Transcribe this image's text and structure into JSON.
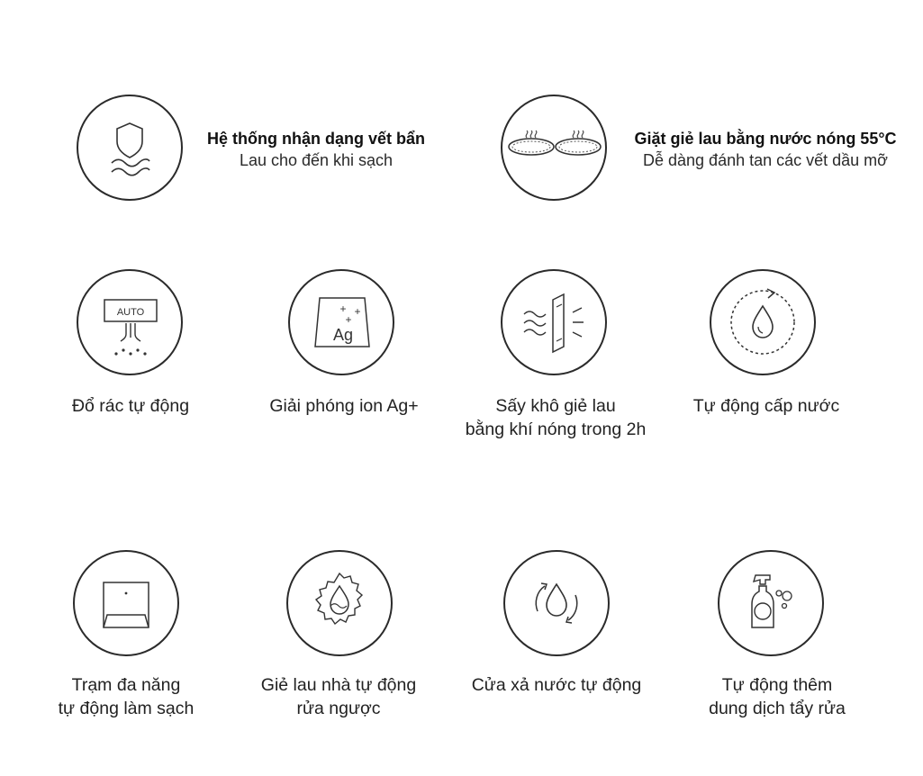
{
  "top_features": [
    {
      "title": "Hệ thống nhận dạng vết bẩn",
      "subtitle": "Lau cho đến khi sạch",
      "icon": "shield-water-icon"
    },
    {
      "title": "Giặt giẻ lau bằng nước nóng 55°C",
      "subtitle": "Dễ dàng đánh tan các vết dầu mỡ",
      "icon": "hot-mop-pads-icon"
    }
  ],
  "row2": [
    {
      "line1": "Đổ rác tự động",
      "line2": "",
      "icon": "auto-empty-icon",
      "icon_text": "AUTO"
    },
    {
      "line1": "Giải phóng ion Ag+",
      "line2": "",
      "icon": "silver-ion-icon",
      "icon_text": "Ag"
    },
    {
      "line1": "Sấy khô giẻ lau",
      "line2": "bằng khí nóng trong 2h",
      "icon": "hot-air-dry-icon"
    },
    {
      "line1": "Tự động cấp nước",
      "line2": "",
      "icon": "water-refill-icon"
    }
  ],
  "row3": [
    {
      "line1": "Trạm đa năng",
      "line2": "tự động làm sạch",
      "icon": "base-station-icon"
    },
    {
      "line1": "Giẻ lau nhà tự động",
      "line2": "rửa ngược",
      "icon": "mop-self-wash-icon"
    },
    {
      "line1": "Cửa xả nước tự động",
      "line2": "",
      "icon": "water-drain-cycle-icon"
    },
    {
      "line1": "Tự động thêm",
      "line2": "dung dịch tẩy rửa",
      "icon": "detergent-bottle-icon"
    }
  ],
  "colors": {
    "stroke": "#2b2b2b",
    "text": "#222222",
    "background": "#ffffff"
  }
}
